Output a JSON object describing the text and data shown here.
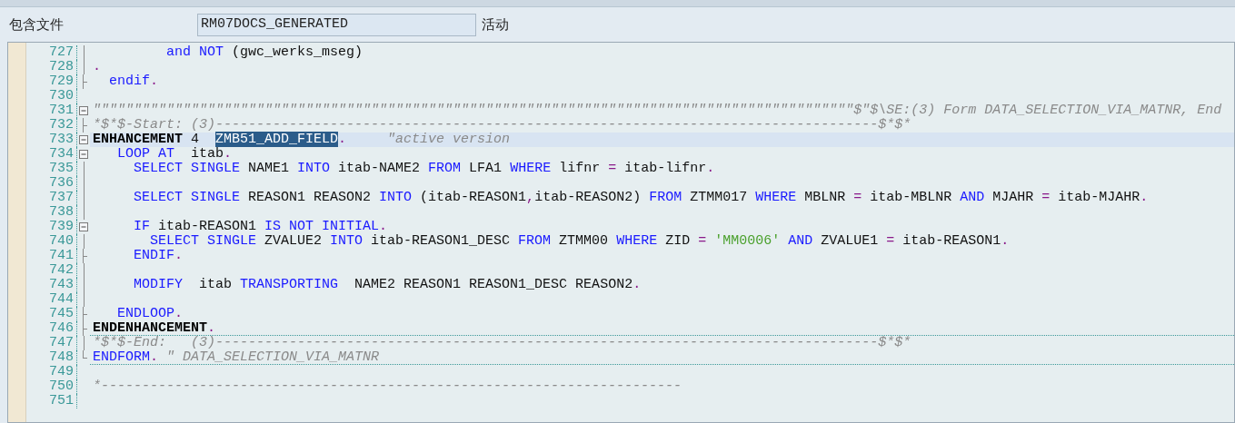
{
  "header": {
    "label": "包含文件",
    "field_value": "RM07DOCS_GENERATED",
    "status": "活动"
  },
  "lines": [
    {
      "number": "727",
      "fold_marker": {
        "kind": "bar"
      },
      "current": false,
      "rule_below": false,
      "tokens": [
        {
          "kind": "keyword",
          "text": "         and"
        },
        {
          "kind": "keyword",
          "text": " NOT"
        },
        {
          "kind": "text",
          "text": " (gwc_werks_mseg)"
        }
      ]
    },
    {
      "number": "728",
      "fold_marker": {
        "kind": "bar"
      },
      "current": false,
      "rule_below": false,
      "tokens": [
        {
          "kind": "operator",
          "text": "."
        }
      ]
    },
    {
      "number": "729",
      "fold_marker": {
        "kind": "tick"
      },
      "current": false,
      "rule_below": false,
      "tokens": [
        {
          "kind": "keyword",
          "text": "  endif"
        },
        {
          "kind": "operator",
          "text": "."
        }
      ]
    },
    {
      "number": "730"
    },
    {
      "number": "731",
      "fold_marker": {
        "kind": "toggle"
      },
      "current": false,
      "rule_below": false,
      "tokens": [
        {
          "kind": "comment",
          "text": "\"\"\"\"\"\"\"\"\"\"\"\"\"\"\"\"\"\"\"\"\"\"\"\"\"\"\"\"\"\"\"\"\"\"\"\"\"\"\"\"\"\"\"\"\"\"\"\"\"\"\"\"\"\"\"\"\"\"\"\"\"\"\"\"\"\"\"\"\"\"\"\"\"\"\"\"\"\"\"\"\"\"\"\"\"\"\"\"\"\"\"\"\"$\"$\\SE:(3) Form DATA_SELECTION_VIA_MATNR, End"
        }
      ]
    },
    {
      "number": "732",
      "fold_marker": {
        "kind": "tick"
      },
      "current": false,
      "rule_below": false,
      "tokens": [
        {
          "kind": "comment",
          "text": "*$*$-Start: (3)---------------------------------------------------------------------------------$*$*"
        }
      ]
    },
    {
      "number": "733",
      "fold_marker": {
        "kind": "toggle"
      },
      "current": true,
      "rule_below": false,
      "tokens": [
        {
          "kind": "bold",
          "text": "ENHANCEMENT"
        },
        {
          "kind": "text",
          "text": " 4  "
        },
        {
          "kind": "selected",
          "text": "ZMB51_ADD_FIELD"
        },
        {
          "kind": "operator",
          "text": "."
        },
        {
          "kind": "comment",
          "text": "     \"active version"
        }
      ]
    },
    {
      "number": "734",
      "fold_marker": {
        "kind": "toggle"
      },
      "current": false,
      "rule_below": false,
      "tokens": [
        {
          "kind": "keyword",
          "text": "   LOOP AT"
        },
        {
          "kind": "text",
          "text": "  itab"
        },
        {
          "kind": "operator",
          "text": "."
        }
      ]
    },
    {
      "number": "735",
      "fold_marker": {
        "kind": "bar"
      },
      "current": false,
      "rule_below": false,
      "tokens": [
        {
          "kind": "keyword",
          "text": "     SELECT SINGLE"
        },
        {
          "kind": "text",
          "text": " NAME1"
        },
        {
          "kind": "keyword",
          "text": " INTO"
        },
        {
          "kind": "text",
          "text": " itab-NAME2"
        },
        {
          "kind": "keyword",
          "text": " FROM"
        },
        {
          "kind": "text",
          "text": " LFA1"
        },
        {
          "kind": "keyword",
          "text": " WHERE"
        },
        {
          "kind": "text",
          "text": " lifnr"
        },
        {
          "kind": "operator",
          "text": " ="
        },
        {
          "kind": "text",
          "text": " itab-lifnr"
        },
        {
          "kind": "operator",
          "text": "."
        }
      ]
    },
    {
      "number": "736",
      "fold_marker": {
        "kind": "bar"
      }
    },
    {
      "number": "737",
      "fold_marker": {
        "kind": "bar"
      },
      "current": false,
      "rule_below": false,
      "tokens": [
        {
          "kind": "keyword",
          "text": "     SELECT SINGLE"
        },
        {
          "kind": "text",
          "text": " REASON1 REASON2"
        },
        {
          "kind": "keyword",
          "text": " INTO"
        },
        {
          "kind": "text",
          "text": " (itab-REASON1"
        },
        {
          "kind": "operator",
          "text": ","
        },
        {
          "kind": "text",
          "text": "itab-REASON2)"
        },
        {
          "kind": "keyword",
          "text": " FROM"
        },
        {
          "kind": "text",
          "text": " ZTMM017"
        },
        {
          "kind": "keyword",
          "text": " WHERE"
        },
        {
          "kind": "text",
          "text": " MBLNR"
        },
        {
          "kind": "operator",
          "text": " ="
        },
        {
          "kind": "text",
          "text": " itab-MBLNR"
        },
        {
          "kind": "keyword",
          "text": " AND"
        },
        {
          "kind": "text",
          "text": " MJAHR"
        },
        {
          "kind": "operator",
          "text": " ="
        },
        {
          "kind": "text",
          "text": " itab-MJAHR"
        },
        {
          "kind": "operator",
          "text": "."
        }
      ]
    },
    {
      "number": "738",
      "fold_marker": {
        "kind": "bar"
      }
    },
    {
      "number": "739",
      "fold_marker": {
        "kind": "toggle"
      },
      "current": false,
      "rule_below": false,
      "tokens": [
        {
          "kind": "keyword",
          "text": "     IF"
        },
        {
          "kind": "text",
          "text": " itab-REASON1"
        },
        {
          "kind": "keyword",
          "text": " IS NOT INITIAL"
        },
        {
          "kind": "operator",
          "text": "."
        }
      ]
    },
    {
      "number": "740",
      "fold_marker": {
        "kind": "bar"
      },
      "current": false,
      "rule_below": false,
      "tokens": [
        {
          "kind": "keyword",
          "text": "       SELECT SINGLE"
        },
        {
          "kind": "text",
          "text": " ZVALUE2"
        },
        {
          "kind": "keyword",
          "text": " INTO"
        },
        {
          "kind": "text",
          "text": " itab-REASON1_DESC"
        },
        {
          "kind": "keyword",
          "text": " FROM"
        },
        {
          "kind": "text",
          "text": " ZTMM00"
        },
        {
          "kind": "keyword",
          "text": " WHERE"
        },
        {
          "kind": "text",
          "text": " ZID"
        },
        {
          "kind": "operator",
          "text": " ="
        },
        {
          "kind": "string",
          "text": " 'MM0006'"
        },
        {
          "kind": "keyword",
          "text": " AND"
        },
        {
          "kind": "text",
          "text": " ZVALUE1"
        },
        {
          "kind": "operator",
          "text": " ="
        },
        {
          "kind": "text",
          "text": " itab-REASON1"
        },
        {
          "kind": "operator",
          "text": "."
        }
      ]
    },
    {
      "number": "741",
      "fold_marker": {
        "kind": "tick"
      },
      "current": false,
      "rule_below": false,
      "tokens": [
        {
          "kind": "keyword",
          "text": "     ENDIF"
        },
        {
          "kind": "operator",
          "text": "."
        }
      ]
    },
    {
      "number": "742",
      "fold_marker": {
        "kind": "bar"
      }
    },
    {
      "number": "743",
      "fold_marker": {
        "kind": "bar"
      },
      "current": false,
      "rule_below": false,
      "tokens": [
        {
          "kind": "keyword",
          "text": "     MODIFY"
        },
        {
          "kind": "text",
          "text": "  itab"
        },
        {
          "kind": "keyword",
          "text": " TRANSPORTING"
        },
        {
          "kind": "text",
          "text": "  NAME2 REASON1 REASON1_DESC REASON2"
        },
        {
          "kind": "operator",
          "text": "."
        }
      ]
    },
    {
      "number": "744",
      "fold_marker": {
        "kind": "bar"
      }
    },
    {
      "number": "745",
      "fold_marker": {
        "kind": "tick"
      },
      "current": false,
      "rule_below": false,
      "tokens": [
        {
          "kind": "keyword",
          "text": "   ENDLOOP"
        },
        {
          "kind": "operator",
          "text": "."
        }
      ]
    },
    {
      "number": "746",
      "fold_marker": {
        "kind": "tick"
      },
      "current": false,
      "rule_below": true,
      "tokens": [
        {
          "kind": "bold",
          "text": "ENDENHANCEMENT"
        },
        {
          "kind": "operator",
          "text": "."
        }
      ]
    },
    {
      "number": "747",
      "fold_marker": {
        "kind": "bar"
      },
      "current": false,
      "rule_below": false,
      "tokens": [
        {
          "kind": "comment",
          "text": "*$*$-End:   (3)---------------------------------------------------------------------------------$*$*"
        }
      ]
    },
    {
      "number": "748",
      "fold_marker": {
        "kind": "end"
      },
      "current": false,
      "rule_below": true,
      "tokens": [
        {
          "kind": "keyword",
          "text": "ENDFORM"
        },
        {
          "kind": "operator",
          "text": "."
        },
        {
          "kind": "comment",
          "text": " \" DATA_SELECTION_VIA_MATNR"
        }
      ]
    },
    {
      "number": "749"
    },
    {
      "number": "750",
      "current": false,
      "rule_below": false,
      "tokens": [
        {
          "kind": "comment",
          "text": "*-----------------------------------------------------------------------"
        }
      ]
    },
    {
      "number": "751"
    }
  ]
}
